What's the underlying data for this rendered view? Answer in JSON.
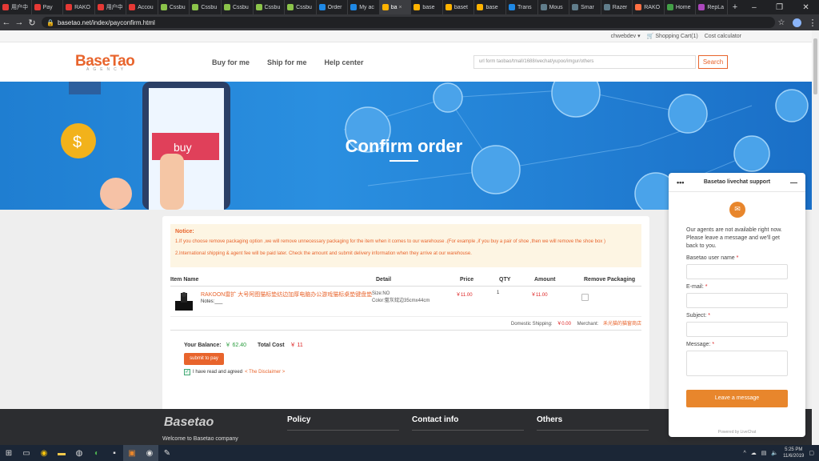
{
  "browser": {
    "tabs": [
      {
        "label": "用户中",
        "color": "#e53935"
      },
      {
        "label": "Pay",
        "color": "#e53935"
      },
      {
        "label": "RAKO",
        "color": "#e53935"
      },
      {
        "label": "用户中",
        "color": "#e53935"
      },
      {
        "label": "Accou",
        "color": "#e53935"
      },
      {
        "label": "Cssbu",
        "color": "#8bc34a"
      },
      {
        "label": "Cssbu",
        "color": "#8bc34a"
      },
      {
        "label": "Cssbu",
        "color": "#8bc34a"
      },
      {
        "label": "Cssbu",
        "color": "#8bc34a"
      },
      {
        "label": "Cssbu",
        "color": "#8bc34a"
      },
      {
        "label": "Order",
        "color": "#1e88e5"
      },
      {
        "label": "My ac",
        "color": "#1e88e5"
      },
      {
        "label": "ba",
        "color": "#ffb300",
        "active": true
      },
      {
        "label": "base",
        "color": "#ffb300"
      },
      {
        "label": "baset",
        "color": "#ffb300"
      },
      {
        "label": "base",
        "color": "#ffb300"
      },
      {
        "label": "Trans",
        "color": "#1e88e5"
      },
      {
        "label": "Mous",
        "color": "#607d8b"
      },
      {
        "label": "Smar",
        "color": "#607d8b"
      },
      {
        "label": "Razer",
        "color": "#607d8b"
      },
      {
        "label": "RAKO",
        "color": "#ff7043"
      },
      {
        "label": "Home",
        "color": "#43a047"
      },
      {
        "label": "RepLa",
        "color": "#ab47bc"
      }
    ],
    "url": "basetao.net/index/payconfirm.html"
  },
  "topstrip": {
    "user": "chwebdev",
    "cart": "Shopping Cart(1)",
    "calc": "Cost calculator"
  },
  "header": {
    "logo": "BaseTao",
    "logo_sub": "AGENCY",
    "nav": [
      "Buy for me",
      "Ship for me",
      "Help center"
    ],
    "search_placeholder": "url form taobao/tmall/1688/wechat/yupoo/imgur/others",
    "search_btn": "Search"
  },
  "banner": {
    "title": "Confirm order",
    "buy_label": "buy"
  },
  "order": {
    "notice_title": "Notice:",
    "notice_1": "1.If you choose remove packaging option ,we will remove unnecessary packaging for the item when it comes to our warehouse .(For example ,if you buy a pair of shoe ,then we will remove the shoe box )",
    "notice_2": "2.International shipping & agent fee will be paid later. Check the amount and submit delivery information when they arrive at our warehouse.",
    "headers": [
      "Item Name",
      "Detail",
      "Price",
      "QTY",
      "Amount",
      "Remove Packaging"
    ],
    "item": {
      "name": "RAKOON雷扩 大号阿图猫标垫纺边加厚电脑办公游戏猫标桌垫键盘垫",
      "notes": "Notes:___",
      "size": "Size:NO",
      "color": "Color:藍灰鈂边35cmx44cm",
      "price": "￥11.00",
      "qty": "1",
      "amount": "￥11.00"
    },
    "domestic_label": "Domestic Shipping:",
    "domestic_value": "￥0.00",
    "merchant_label": "Merchant:",
    "merchant_value": "禾光猫的猫窗商店",
    "balance_label": "Your Balance:",
    "balance_value": "￥ 62.40",
    "total_label": "Total Cost",
    "total_value": "￥ 11",
    "pay_btn": "submit to pay",
    "agree_text": "I have read and agreed",
    "disclaimer": "< The Disclaimer >"
  },
  "footer": {
    "logo": "Basetao",
    "welcome": "Welcome to Basetao company",
    "cols": [
      "Policy",
      "Contact info",
      "Others"
    ]
  },
  "chat": {
    "title": "Basetao livechat support",
    "message": "Our agents are not available right now. Please leave a message and we'll get back to you.",
    "fields": [
      "Basetao user name",
      "E-mail:",
      "Subject:",
      "Message:"
    ],
    "submit": "Leave a message",
    "powered": "Powered by LiveChat"
  },
  "taskbar": {
    "time": "5:25 PM",
    "date": "11/6/2019"
  }
}
